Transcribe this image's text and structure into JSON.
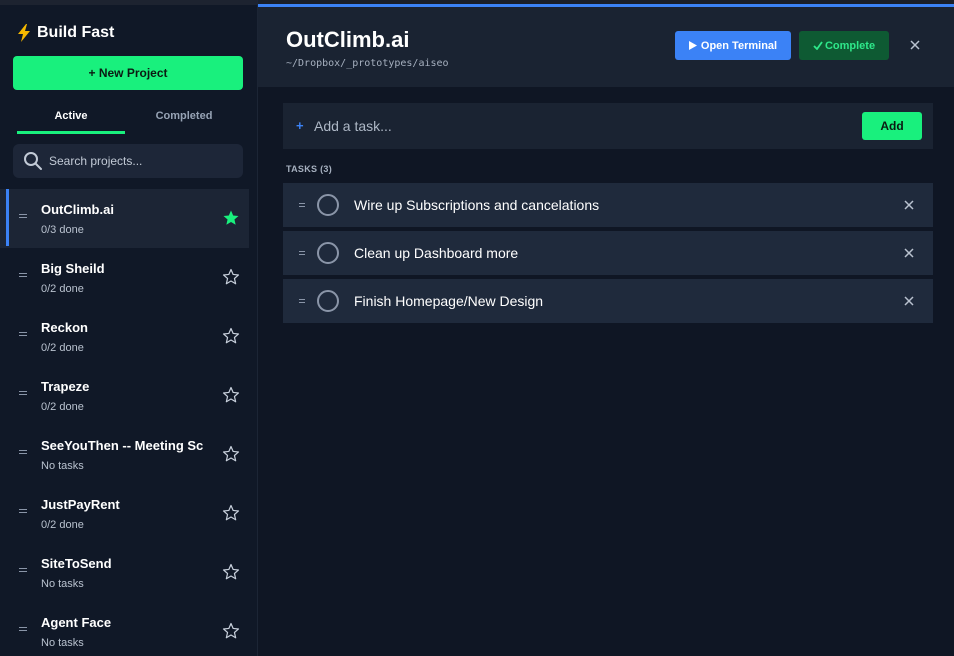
{
  "sidebar": {
    "brand": "Build Fast",
    "new_project_label": "+ New Project",
    "tabs": [
      {
        "label": "Active",
        "active": true
      },
      {
        "label": "Completed",
        "active": false
      }
    ],
    "search_placeholder": "Search projects...",
    "projects": [
      {
        "name": "OutClimb.ai",
        "status": "0/3 done",
        "starred": true,
        "selected": true
      },
      {
        "name": "Big Sheild",
        "status": "0/2 done",
        "starred": false,
        "selected": false
      },
      {
        "name": "Reckon",
        "status": "0/2 done",
        "starred": false,
        "selected": false
      },
      {
        "name": "Trapeze",
        "status": "0/2 done",
        "starred": false,
        "selected": false
      },
      {
        "name": "SeeYouThen -- Meeting Sc",
        "status": "No tasks",
        "starred": false,
        "selected": false
      },
      {
        "name": "JustPayRent",
        "status": "0/2 done",
        "starred": false,
        "selected": false
      },
      {
        "name": "SiteToSend",
        "status": "No tasks",
        "starred": false,
        "selected": false
      },
      {
        "name": "Agent Face",
        "status": "No tasks",
        "starred": false,
        "selected": false
      }
    ]
  },
  "main": {
    "title": "OutClimb.ai",
    "path": "~/Dropbox/_prototypes/aiseo",
    "open_terminal_label": "Open Terminal",
    "complete_label": "Complete",
    "add_task_placeholder": "Add a task...",
    "add_button_label": "Add",
    "tasks_heading": "TASKS (3)",
    "tasks": [
      {
        "text": "Wire up Subscriptions and cancelations"
      },
      {
        "text": "Clean up Dashboard more"
      },
      {
        "text": "Finish Homepage/New Design"
      }
    ]
  },
  "colors": {
    "accent_green": "#19f07d",
    "accent_blue": "#3b82f6",
    "complete_bg": "#0e5a33",
    "sidebar_bg": "#101827",
    "main_bg": "#0f1624"
  },
  "icons": {
    "brand": "lightning-bolt-icon",
    "search": "search-icon",
    "star_filled": "star-filled-icon",
    "star_outline": "star-outline-icon",
    "drag": "drag-handle-icon",
    "close": "close-icon",
    "play": "play-icon",
    "check": "check-icon"
  }
}
